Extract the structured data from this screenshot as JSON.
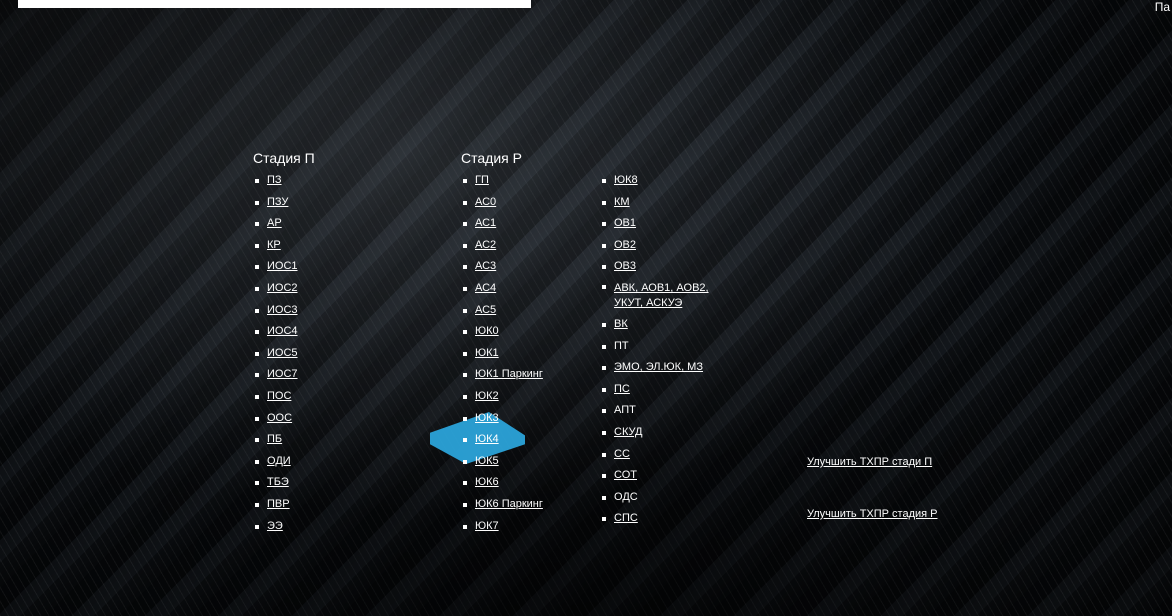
{
  "corner_text": "Па",
  "stage_p": {
    "title": "Стадия П",
    "items": [
      "ПЗ",
      "ПЗУ",
      "АР",
      "КР",
      "ИОС1",
      "ИОС2",
      "ИОС3",
      "ИОС4",
      "ИОС5",
      "ИОС7",
      "ПОС",
      "ООС",
      "ПБ",
      "ОДИ",
      "ТБЭ",
      "ПВР",
      "ЭЭ"
    ]
  },
  "stage_r": {
    "title": "Стадия Р",
    "col1": [
      "ГП",
      "АС0",
      "АС1",
      "АС2",
      "АС3",
      "АС4",
      "АС5",
      "ЮК0",
      "ЮК1",
      "ЮК1 Паркинг",
      "ЮК2",
      "ЮК3",
      "ЮК4",
      "ЮК5",
      "ЮК6",
      "ЮК6 Паркинг",
      "ЮК7"
    ],
    "col2": [
      "ЮК8",
      "КМ",
      "ОВ1",
      "ОВ2",
      "ОВ3",
      "АВК, АОВ1, АОВ2, УКУТ, АСКУЭ",
      "ВК",
      "ПТ",
      "ЭМО, ЭЛ.ЮК, МЗ",
      "ПС",
      "АПТ",
      "СКУД",
      "СС",
      "СОТ",
      "ОДС",
      "СПС"
    ]
  },
  "links": {
    "improve_p": "Улучшить ТХПР стади П",
    "improve_r": "Улучшить ТХПР стадия Р"
  },
  "colors": {
    "text": "#ffffff",
    "accent_tile": "#2ba3d9"
  }
}
